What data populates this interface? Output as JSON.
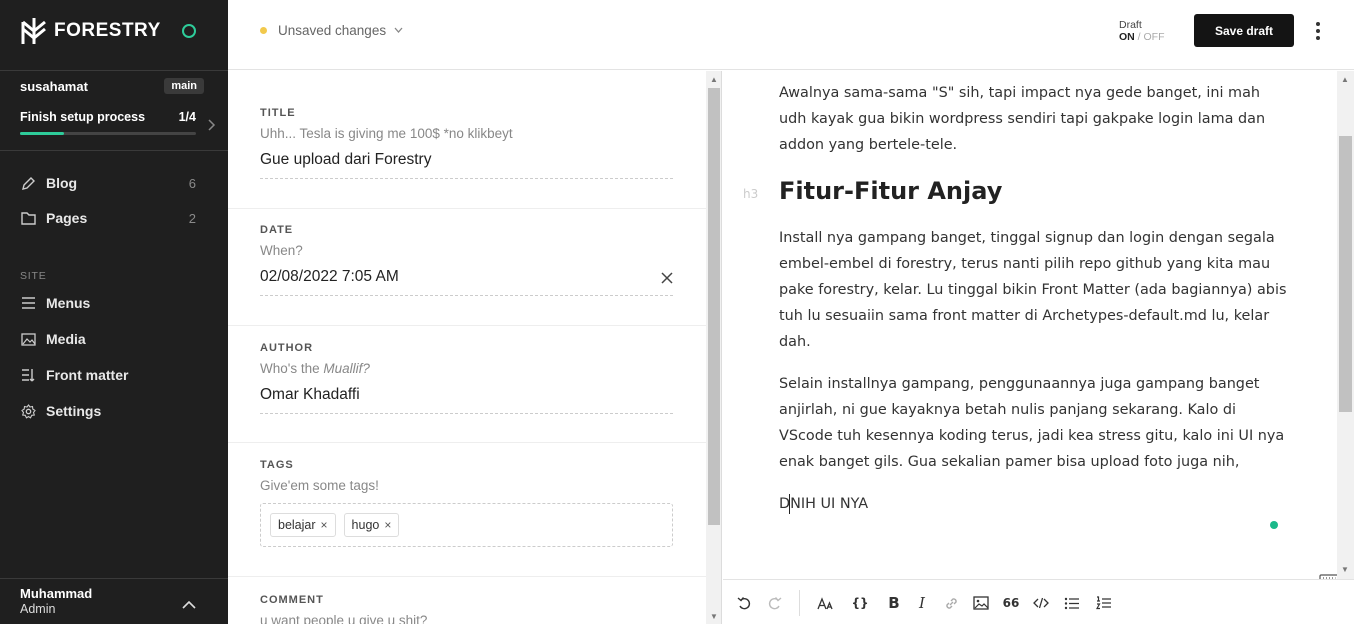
{
  "sidebar": {
    "brand": "FORESTRY",
    "site_name": "susahamat",
    "branch": "main",
    "setup": {
      "label": "Finish setup process",
      "progress_text": "1/4",
      "progress_fraction": 0.25
    },
    "nav": [
      {
        "label": "Blog",
        "count": "6",
        "icon": "blog-icon"
      },
      {
        "label": "Pages",
        "count": "2",
        "icon": "pages-icon"
      }
    ],
    "section_label": "SITE",
    "site_nav": [
      {
        "label": "Menus",
        "icon": "menu-icon"
      },
      {
        "label": "Media",
        "icon": "image-icon"
      },
      {
        "label": "Front matter",
        "icon": "front-matter-icon"
      },
      {
        "label": "Settings",
        "icon": "gear-icon"
      }
    ],
    "user": {
      "name": "Muhammad",
      "role": "Admin"
    }
  },
  "topbar": {
    "status": "Unsaved changes",
    "draft_label": "Draft",
    "draft_on": "ON",
    "draft_slash": " / ",
    "draft_off": "OFF",
    "save_label": "Save draft"
  },
  "form": {
    "title": {
      "label": "TITLE",
      "hint": "Uhh... Tesla is giving me 100$ *no klikbeyt",
      "value": "Gue upload dari Forestry"
    },
    "date": {
      "label": "DATE",
      "hint": "When?",
      "value": "02/08/2022 7:05 AM"
    },
    "author": {
      "label": "AUTHOR",
      "hint_prefix": "Who's the ",
      "hint_em": "Muallif?",
      "value": "Omar Khadaffi"
    },
    "tags": {
      "label": "TAGS",
      "hint": "Give'em some tags!",
      "items": [
        "belajar",
        "hugo"
      ]
    },
    "comment": {
      "label": "COMMENT",
      "hint": "u want people u give u shit?"
    }
  },
  "editor": {
    "para1": "Awalnya sama-sama \"S\" sih, tapi impact nya gede banget, ini mah udh kayak gua bikin wordpress sendiri tapi gakpake login lama dan addon yang bertele-tele.",
    "heading_tag": "h3",
    "heading": "Fitur-Fitur Anjay",
    "para2": "Install nya gampang banget, tinggal signup dan login dengan segala embel-embel di forestry, terus nanti pilih repo github yang kita mau pake forestry, kelar. Lu tinggal bikin Front Matter (ada bagiannya) abis tuh lu sesuaiin sama front matter di Archetypes-default.md lu, kelar dah.",
    "para3": "Selain installnya gampang, penggunaannya juga gampang banget anjirlah, ni gue kayaknya betah nulis panjang sekarang. Kalo di VScode tuh kesennya koding terus, jadi kea stress gitu, kalo ini UI nya enak banget gils. Gua sekalian pamer bisa upload foto juga nih,",
    "para4": "DNIH UI NYA"
  },
  "toolbar": {
    "icons": [
      "undo-icon",
      "redo-icon",
      "text-size-icon",
      "curly-braces-icon",
      "bold-icon",
      "italic-icon",
      "link-icon",
      "image-icon",
      "quote-icon",
      "code-icon",
      "bullet-list-icon",
      "numbered-list-icon"
    ],
    "bold": "B",
    "italic": "I",
    "quote": "66",
    "braces": "{}"
  },
  "colors": {
    "accent": "#2ecc9a",
    "sidebar_bg": "#1f1f1f",
    "unsaved_dot": "#f2c94c",
    "save_button": "#141414"
  }
}
